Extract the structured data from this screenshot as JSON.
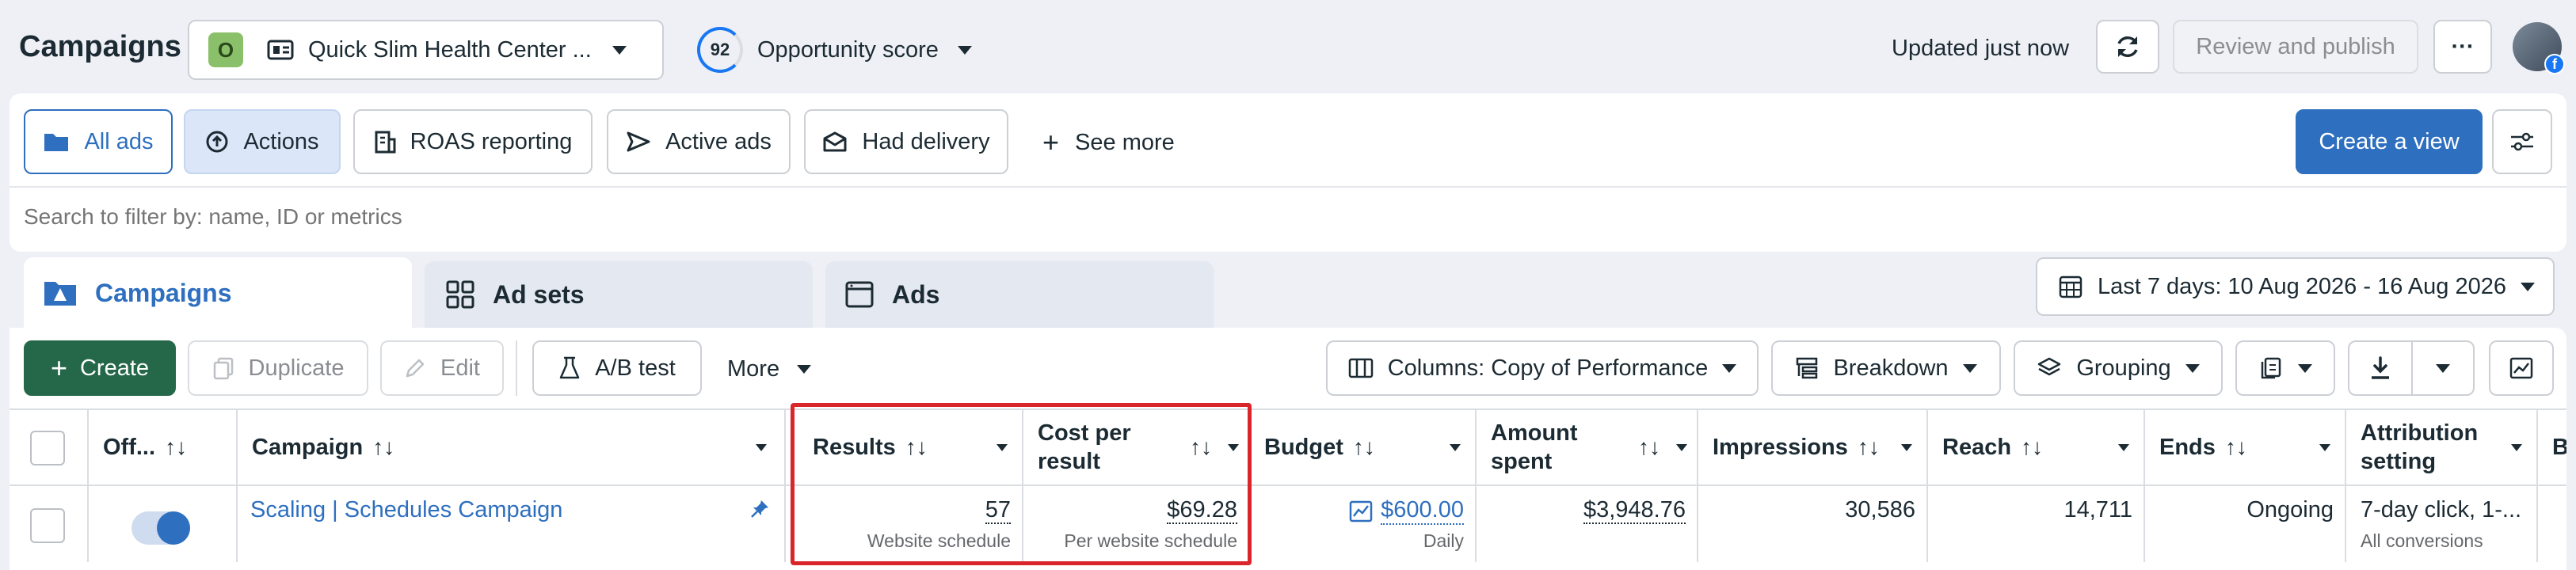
{
  "page_title": "Campaigns",
  "account": {
    "avatar_letter": "O",
    "name": "Quick Slim Health Center ..."
  },
  "opportunity": {
    "score": "92",
    "label": "Opportunity score"
  },
  "header": {
    "updated": "Updated just now",
    "review_publish": "Review and publish",
    "more": "···"
  },
  "views": {
    "all_ads": "All ads",
    "actions": "Actions",
    "roas": "ROAS reporting",
    "active_ads": "Active ads",
    "had_delivery": "Had delivery",
    "see_more": "See more",
    "create_view": "Create a view"
  },
  "search": {
    "placeholder": "Search to filter by: name, ID or metrics"
  },
  "tabs": {
    "campaigns": "Campaigns",
    "ad_sets": "Ad sets",
    "ads": "Ads"
  },
  "date_range": "Last 7 days: 10 Aug 2026 - 16 Aug 2026",
  "toolbar": {
    "create": "Create",
    "duplicate": "Duplicate",
    "edit": "Edit",
    "ab_test": "A/B test",
    "more": "More",
    "columns": "Columns: Copy of Performance",
    "breakdown": "Breakdown",
    "grouping": "Grouping"
  },
  "table": {
    "headers": {
      "toggle": "Off...",
      "campaign": "Campaign",
      "results": "Results",
      "cost_per_result_1": "Cost per",
      "cost_per_result_2": "result",
      "budget": "Budget",
      "amount_spent_1": "Amount",
      "amount_spent_2": "spent",
      "impressions": "Impressions",
      "reach": "Reach",
      "ends": "Ends",
      "attribution_1": "Attribution",
      "attribution_2": "setting",
      "bid": "Bi"
    },
    "row": {
      "campaign": "Scaling | Schedules Campaign",
      "results": "57",
      "results_sub": "Website schedule",
      "cost_per_result": "$69.28",
      "cost_per_result_sub": "Per website schedule",
      "budget": "$600.00",
      "budget_sub": "Daily",
      "amount_spent": "$3,948.76",
      "impressions": "30,586",
      "reach": "14,711",
      "ends": "Ongoing",
      "attribution": "7-day click, 1-...",
      "attribution_sub": "All conversions"
    }
  },
  "colors": {
    "primary": "#2e6fbf",
    "create_green": "#256849",
    "highlight_red": "#d9262b",
    "selected_view": "#dbe7f8"
  }
}
